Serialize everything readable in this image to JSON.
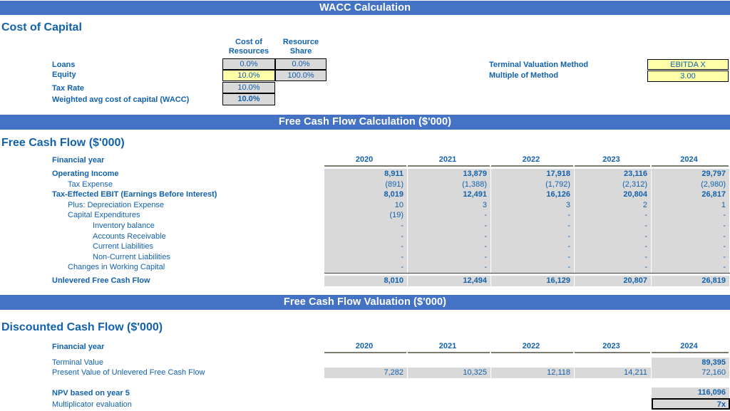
{
  "banners": {
    "wacc": "WACC Calculation",
    "fcf": "Free Cash Flow Calculation ($'000)",
    "fcf_valuation": "Free Cash Flow Valuation ($'000)"
  },
  "cost_of_capital": {
    "section_title": "Cost of Capital",
    "column_headers": [
      "Cost of Resources",
      "Resource Share"
    ],
    "column_header_lines": {
      "cost_of_resources_1": "Cost of",
      "cost_of_resources_2": "Resources",
      "resource_share_1": "Resource",
      "resource_share_2": "Share"
    },
    "rows": [
      {
        "label": "Loans",
        "cost_of_resources": "0.0%",
        "resource_share": "0.0%"
      },
      {
        "label": "Equity",
        "cost_of_resources": "10.0%",
        "resource_share": "100.0%"
      },
      {
        "label": "Tax Rate",
        "cost_of_resources": "10.0%",
        "resource_share": ""
      },
      {
        "label": "Weighted avg cost of capital (WACC)",
        "cost_of_resources": "10.0%",
        "resource_share": ""
      }
    ]
  },
  "terminal": {
    "method_label": "Terminal Valuation Method",
    "method_value": "EBITDA X",
    "multiple_label": "Multiple of Method",
    "multiple_value": "3.00"
  },
  "free_cash_flow": {
    "section_title": "Free Cash Flow ($'000)",
    "financial_year_label": "Financial year",
    "years": [
      "2020",
      "2021",
      "2022",
      "2023",
      "2024"
    ],
    "rows": [
      {
        "label": "Operating Income",
        "indent": 0,
        "bold": true,
        "values": [
          "8,911",
          "13,879",
          "17,918",
          "23,116",
          "29,797"
        ]
      },
      {
        "label": "Tax Expense",
        "indent": 1,
        "bold": false,
        "values": [
          "(891)",
          "(1,388)",
          "(1,792)",
          "(2,312)",
          "(2,980)"
        ]
      },
      {
        "label": "Tax-Effected EBIT (Earnings Before Interest)",
        "indent": 0,
        "bold": true,
        "values": [
          "8,019",
          "12,491",
          "16,126",
          "20,804",
          "26,817"
        ]
      },
      {
        "label": "Plus: Depreciation Expense",
        "indent": 1,
        "bold": false,
        "values": [
          "10",
          "3",
          "3",
          "2",
          "1"
        ]
      },
      {
        "label": "Capital Expenditures",
        "indent": 1,
        "bold": false,
        "values": [
          "(19)",
          "-",
          "-",
          "-",
          "-"
        ]
      },
      {
        "label": "Inventory balance",
        "indent": 2,
        "bold": false,
        "values": [
          "-",
          "-",
          "-",
          "-",
          "-"
        ]
      },
      {
        "label": "Accounts Receivable",
        "indent": 2,
        "bold": false,
        "values": [
          "-",
          "-",
          "-",
          "-",
          "-"
        ]
      },
      {
        "label": "Current Liabilities",
        "indent": 2,
        "bold": false,
        "values": [
          "-",
          "-",
          "-",
          "-",
          "-"
        ]
      },
      {
        "label": "Non-Current Liabilities",
        "indent": 2,
        "bold": false,
        "values": [
          "-",
          "-",
          "-",
          "-",
          "-"
        ]
      },
      {
        "label": "Changes in Working Capital",
        "indent": 1,
        "bold": false,
        "values": [
          "-",
          "-",
          "-",
          "-",
          "-"
        ]
      }
    ],
    "total": {
      "label": "Unlevered Free Cash Flow",
      "values": [
        "8,010",
        "12,494",
        "16,129",
        "20,807",
        "26,819"
      ]
    }
  },
  "discounted_cash_flow": {
    "section_title": "Discounted Cash Flow ($'000)",
    "financial_year_label": "Financial year",
    "years": [
      "2020",
      "2021",
      "2022",
      "2023",
      "2024"
    ],
    "terminal_value": {
      "label": "Terminal Value",
      "values": [
        "",
        "",
        "",
        "",
        "89,395"
      ]
    },
    "present_value": {
      "label": "Present Value of Unlevered Free Cash Flow",
      "values": [
        "7,282",
        "10,325",
        "12,118",
        "14,211",
        "72,160"
      ]
    },
    "npv": {
      "label": "NPV based on year 5",
      "value": "116,096"
    },
    "multiplicator": {
      "label": "Multiplicator evaluation",
      "value": "7x"
    }
  },
  "colors": {
    "banner_blue": "#4472c4",
    "text_blue": "#1261ad",
    "cell_gray": "#d9d9d9",
    "input_yellow": "#ffffa8"
  }
}
